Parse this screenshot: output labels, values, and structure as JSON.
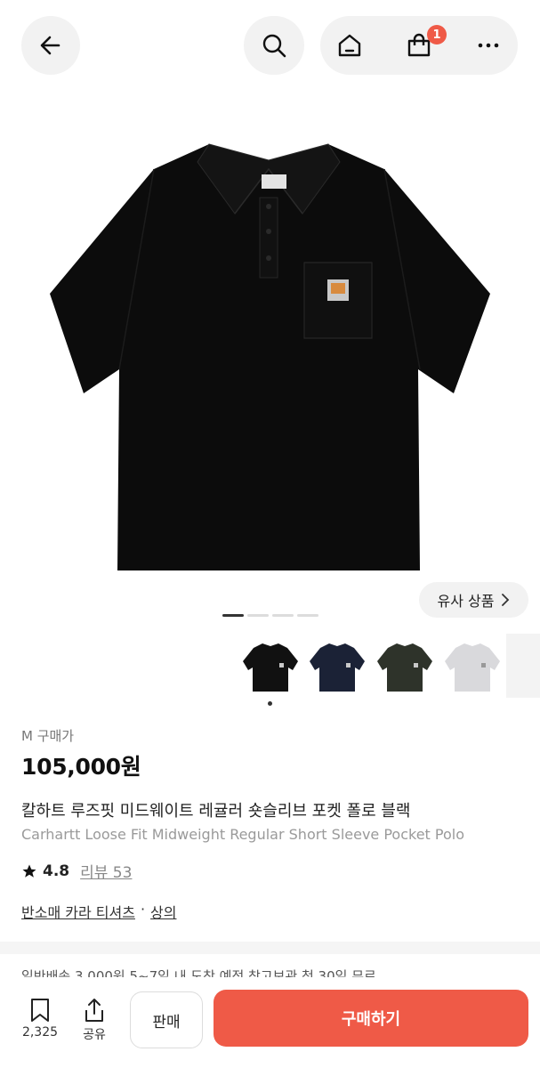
{
  "header": {
    "back_icon": "arrow-left-icon",
    "search_icon": "search-icon",
    "home_icon": "home-icon",
    "cart_icon": "shopping-bag-icon",
    "cart_badge": "1",
    "more_icon": "more-dots-icon"
  },
  "gallery": {
    "similar_label": "유사 상품",
    "slide_count": 4,
    "active_slide": 1,
    "thumbnails": [
      {
        "color_name": "black",
        "hex": "#111111"
      },
      {
        "color_name": "navy",
        "hex": "#1b2236"
      },
      {
        "color_name": "olive",
        "hex": "#2e332a"
      },
      {
        "color_name": "grey",
        "hex": "#d9d9dc"
      }
    ]
  },
  "product": {
    "size_label": "M 구매가",
    "price": "105,000원",
    "title_ko": "칼하트 루즈핏 미드웨이트 레귤러 숏슬리브 포켓 폴로 블랙",
    "title_en": "Carhartt Loose Fit Midweight Regular Short Sleeve Pocket Polo",
    "rating": "4.8",
    "review_label": "리뷰 53",
    "category_1": "반소매 카라 티셔츠",
    "category_sep": "·",
    "category_2": "상의",
    "shipping_text": "일반배송 3,000원 5~7일 내 도착 예정        창고보관 첫 30일 무료"
  },
  "bottom_bar": {
    "bookmark_count": "2,325",
    "share_label": "공유",
    "sell_label": "판매",
    "buy_label": "구매하기"
  },
  "colors": {
    "accent": "#ef5a47",
    "muted_text": "#9a9a9a",
    "pill_bg": "#f2f2f2"
  }
}
